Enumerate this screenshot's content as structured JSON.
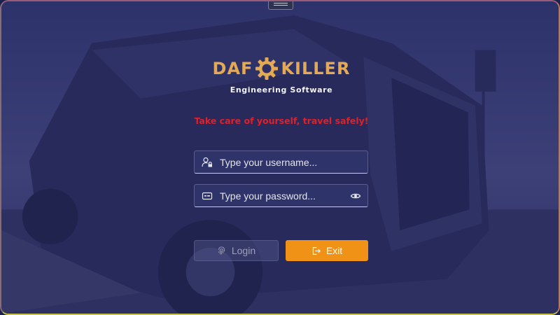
{
  "window": {
    "title_handle": "drag-handle"
  },
  "logo": {
    "brand_left": "DAF",
    "brand_right": "KILLER",
    "subtitle": "Engineering Software"
  },
  "tagline": "Take care of yourself, travel safely!",
  "form": {
    "username_placeholder": "Type your username...",
    "password_placeholder": "Type your password...",
    "username_icon": "user-lock-icon",
    "password_icon": "password-field-icon",
    "reveal_icon": "eye-icon"
  },
  "buttons": {
    "login_label": "Login",
    "login_icon": "fingerprint-icon",
    "exit_label": "Exit",
    "exit_icon": "exit-door-icon"
  },
  "colors": {
    "accent": "#f09216",
    "brand": "#e3a955",
    "tagline": "#e0202a",
    "overlay": "#24286c"
  }
}
